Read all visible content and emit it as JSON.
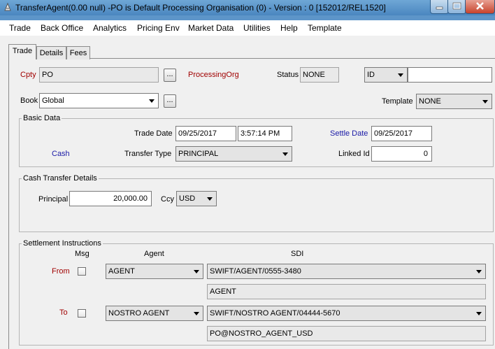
{
  "window": {
    "title": "TransferAgent(0.00 null)  -PO is Default Processing Organisation  (0) - Version : 0  [152012/REL1520]"
  },
  "menu": [
    "Trade",
    "Back Office",
    "Analytics",
    "Pricing Env",
    "Market Data",
    "Utilities",
    "Help",
    "Template"
  ],
  "tabs": [
    "Trade",
    "Details",
    "Fees"
  ],
  "header": {
    "cpty_label": "Cpty",
    "cpty_value": "PO",
    "processing_org": "ProcessingOrg",
    "status_label": "Status",
    "status_value": "NONE",
    "id_combo": "ID",
    "id_value": "",
    "book_label": "Book",
    "book_value": "Global",
    "template_label": "Template",
    "template_value": "NONE",
    "dots": "..."
  },
  "basic_data": {
    "title": "Basic Data",
    "trade_date_label": "Trade Date",
    "trade_date": "09/25/2017",
    "trade_time": "3:57:14 PM",
    "settle_date_label": "Settle Date",
    "settle_date": "09/25/2017",
    "cash_label": "Cash",
    "transfer_type_label": "Transfer Type",
    "transfer_type": "PRINCIPAL",
    "linked_id_label": "Linked Id",
    "linked_id": "0"
  },
  "cash_transfer": {
    "title": "Cash Transfer Details",
    "principal_label": "Principal",
    "principal": "20,000.00",
    "ccy_label": "Ccy",
    "ccy": "USD"
  },
  "settlement": {
    "title": "Settlement Instructions",
    "col_msg": "Msg",
    "col_agent": "Agent",
    "col_sdi": "SDI",
    "from": {
      "label": "From",
      "agent": "AGENT",
      "sdi": "SWIFT/AGENT/0555-3480",
      "detail": "AGENT"
    },
    "to": {
      "label": "To",
      "agent": "NOSTRO AGENT",
      "sdi": "SWIFT/NOSTRO AGENT/04444-5670",
      "detail": "PO@NOSTRO_AGENT_USD"
    }
  },
  "colors": {
    "label_red": "#a00000",
    "label_blue": "#1a1aa6",
    "titlebar": "#4a86c0"
  }
}
